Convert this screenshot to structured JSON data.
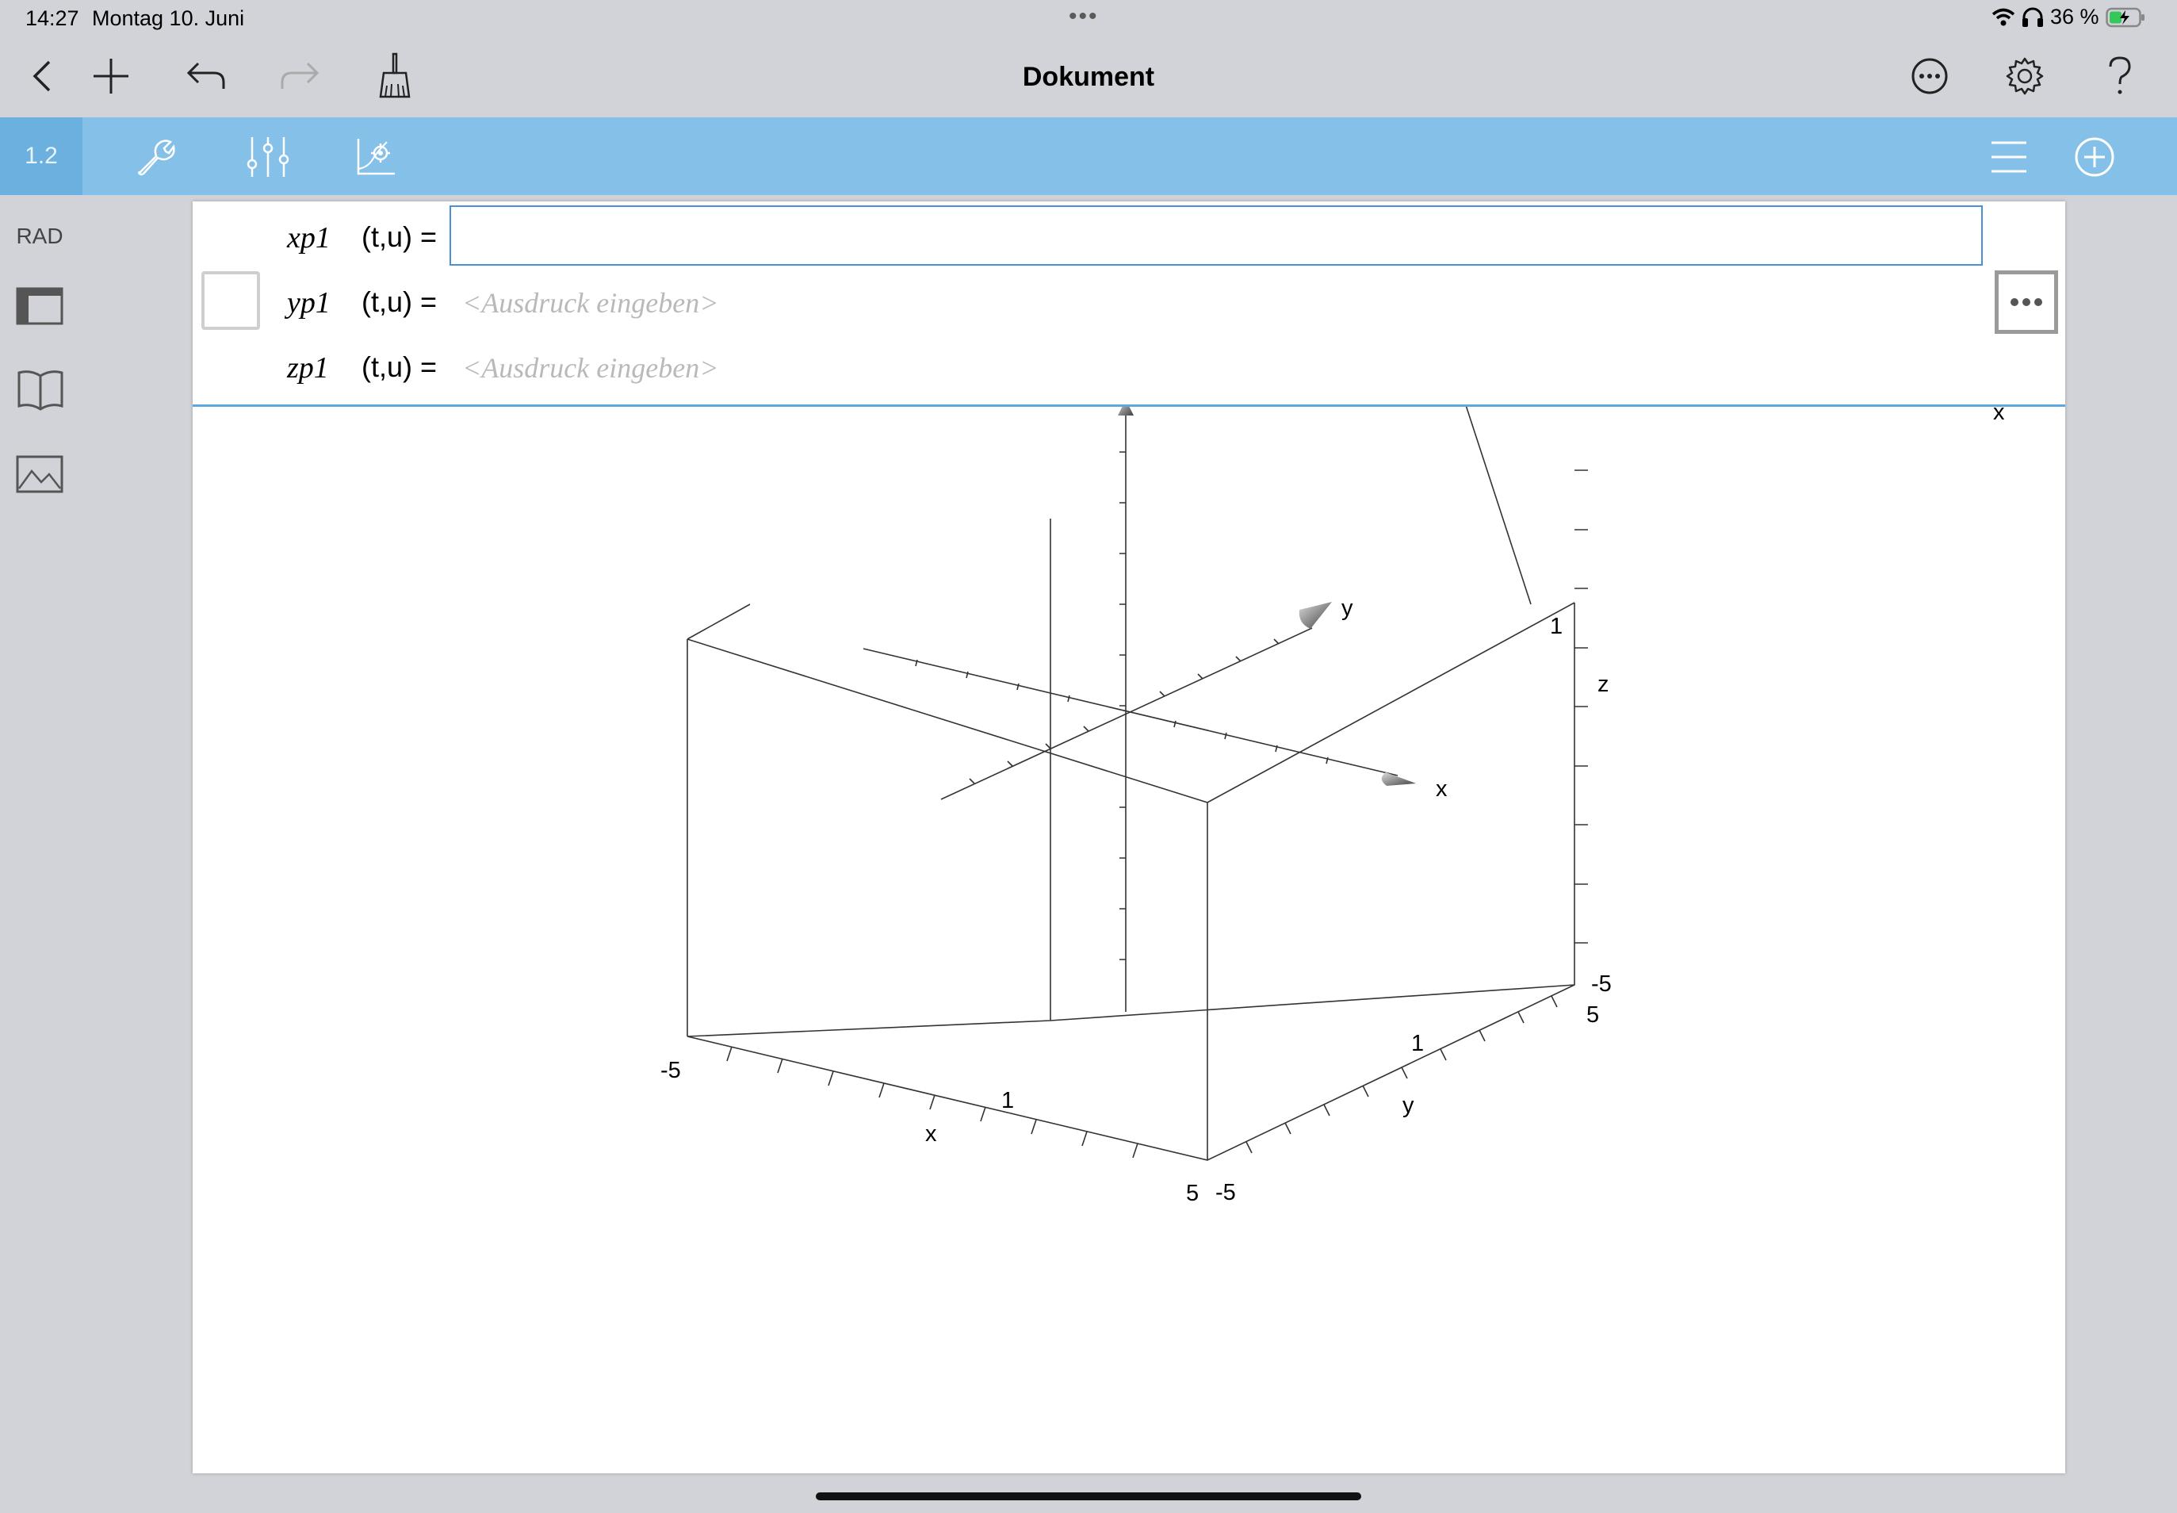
{
  "status_bar": {
    "time": "14:27",
    "date": "Montag 10. Juni",
    "battery": "36 %"
  },
  "toolbar": {
    "title": "Dokument"
  },
  "app_bar": {
    "page_tab": "1.2"
  },
  "sidebar": {
    "angle_mode": "RAD"
  },
  "entry": {
    "rows": [
      {
        "name": "xp1",
        "args": "(t,u) =",
        "value": "",
        "placeholder": ""
      },
      {
        "name": "yp1",
        "args": "(t,u) =",
        "placeholder": "<Ausdruck eingeben>"
      },
      {
        "name": "zp1",
        "args": "(t,u) =",
        "placeholder": "<Ausdruck eingeben>"
      }
    ]
  },
  "graph3d": {
    "axis_labels": {
      "x": "x",
      "y": "y",
      "z": "z",
      "corner_x": "x"
    },
    "box_labels": {
      "x_min": "-5",
      "x_mid": "1",
      "x_max": "5",
      "x_title": "x",
      "y_min": "-5",
      "y_mid": "1",
      "y_max": "5",
      "y_title": "y",
      "z_min": "-5",
      "z_mid": "1",
      "z_title": "z"
    }
  },
  "colors": {
    "app_bar": "#85c0e8",
    "page_tab": "#6cb0df",
    "accent_line": "#5ba8de",
    "input_border": "#4a90d6"
  },
  "icons": [
    "back-icon",
    "add-icon",
    "undo-icon",
    "redo-icon",
    "broom-icon",
    "more-circle-icon",
    "gear-icon",
    "help-icon",
    "wrench-icon",
    "sliders-icon",
    "graph-settings-icon",
    "menu-icon",
    "add-circle-icon",
    "layout-icon",
    "book-icon",
    "image-icon",
    "wifi-icon",
    "headphones-icon",
    "battery-icon"
  ]
}
